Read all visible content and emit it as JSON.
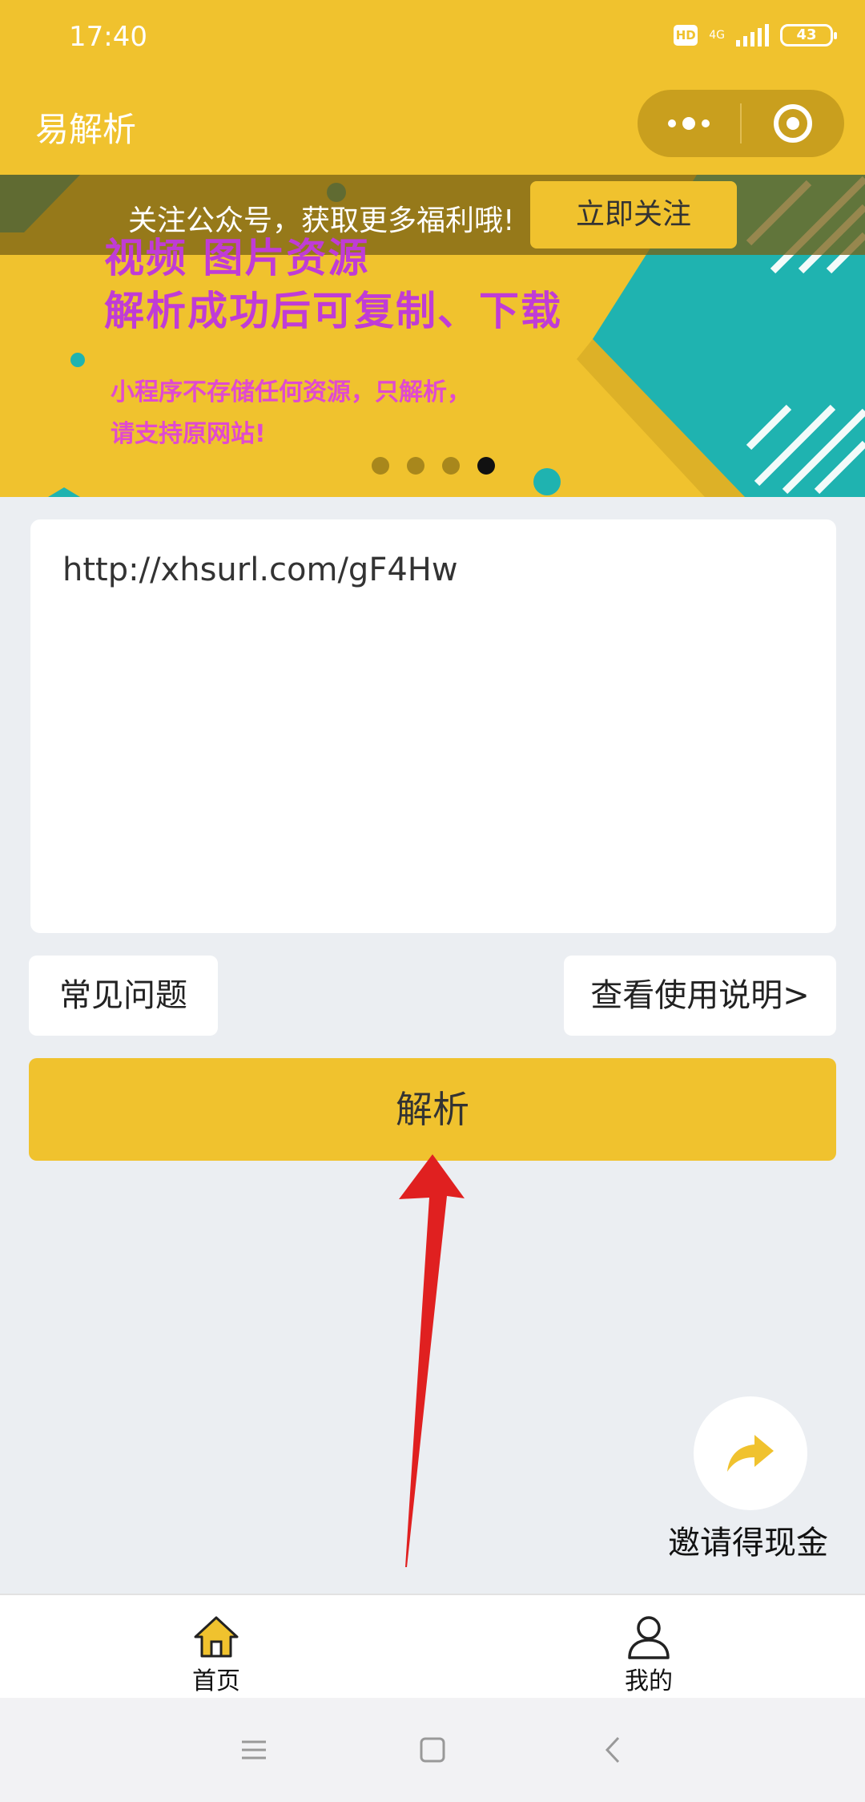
{
  "status_bar": {
    "time": "17:40",
    "hd": "HD",
    "network": "4G",
    "battery": "43"
  },
  "nav": {
    "title": "易解析"
  },
  "banner": {
    "notice": "关注公众号，获取更多福利哦!",
    "follow_label": "立即关注",
    "headline_1": "视频 图片资源",
    "headline_2": "解析成功后可复制、下载",
    "note_1": "小程序不存储任何资源，只解析，",
    "note_2": "请支持原网站!",
    "slides": 4,
    "active_slide": 4
  },
  "url_input": {
    "value": "http://xhsurl.com/gF4Hw"
  },
  "faq_label": "常见问题",
  "guide_label": "查看使用说明>",
  "parse_label": "解析",
  "invite": {
    "label": "邀请得现金"
  },
  "tabs": [
    {
      "label": "首页",
      "icon": "home-icon",
      "active": true
    },
    {
      "label": "我的",
      "icon": "user-icon",
      "active": false
    }
  ],
  "colors": {
    "brand": "#f0c22e",
    "accent_teal": "#1fb3b0",
    "arrow": "#e02020"
  }
}
